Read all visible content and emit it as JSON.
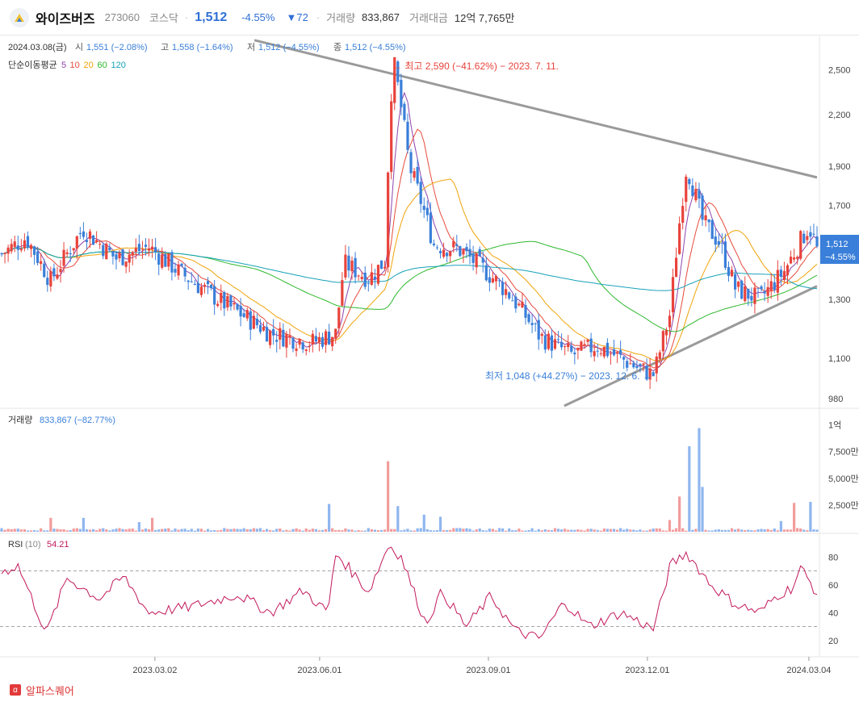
{
  "header": {
    "name": "와이즈버즈",
    "code": "273060",
    "market": "코스닥",
    "price": "1,512",
    "change_rate": "-4.55%",
    "change": "▼72",
    "volume_label": "거래량",
    "volume": "833,867",
    "amount_label": "거래대금",
    "amount": "12억 7,765만"
  },
  "info": {
    "date": "2024.03.08(금)",
    "open_label": "시",
    "open": "1,551 (−2.08%)",
    "high_label": "고",
    "high": "1,558 (−1.64%)",
    "low_label": "저",
    "low": "1,512 (−4.55%)",
    "close_label": "종",
    "close": "1,512 (−4.55%)",
    "ma_label": "단순이동평균",
    "ma_periods": [
      "5",
      "10",
      "20",
      "60",
      "120"
    ],
    "ma_colors": [
      "#8e44ad",
      "#e74c3c",
      "#f0a30a",
      "#2eb82e",
      "#17a2b8"
    ]
  },
  "annotations": {
    "high": "← 최고 2,590 (−41.62%) − 2023. 7. 11.",
    "low": "최저 1,048 (+44.27%) − 2023. 12. 6. →"
  },
  "current_tag": {
    "price": "1,512",
    "rate": "−4.55%"
  },
  "volume_panel": {
    "label": "거래량",
    "value": "833,867 (−82.77%)",
    "ticks": [
      "1억",
      "7,500만",
      "5,000만",
      "2,500만"
    ]
  },
  "rsi_panel": {
    "label": "RSI",
    "period": "(10)",
    "value": "54.21",
    "ticks": [
      "80",
      "60",
      "40",
      "20"
    ]
  },
  "footer": {
    "brand": "알파스퀘어",
    "icon": "α"
  },
  "colors": {
    "up": "#e8433c",
    "down": "#3a7fd9",
    "up_vol": "#f29c9c",
    "down_vol": "#8fb6ef",
    "rsi": "#c2185b",
    "trend": "#9a9a9a"
  },
  "chart_data": {
    "type": "candlestick",
    "price_ticks": [
      "2,500",
      "2,200",
      "1,900",
      "1,700",
      "1,300",
      "1,100",
      "980"
    ],
    "x_ticks": [
      "2023.03.02",
      "2023.06.01",
      "2023.09.01",
      "2023.12.01",
      "2024.03.04"
    ],
    "price_scale": "log",
    "price_range": [
      960,
      2700
    ],
    "volume_range": [
      0,
      105000000
    ],
    "rsi_range": [
      10,
      90
    ],
    "rsi_levels": [
      70,
      30
    ],
    "trendlines": [
      {
        "from": [
          0.31,
          2720
        ],
        "to": [
          1.0,
          1840
        ]
      },
      {
        "from": [
          0.69,
          960
        ],
        "to": [
          1.0,
          1350
        ]
      }
    ],
    "anchors": [
      [
        0,
        1480
      ],
      [
        0.03,
        1550
      ],
      [
        0.06,
        1370
      ],
      [
        0.1,
        1590
      ],
      [
        0.14,
        1460
      ],
      [
        0.18,
        1510
      ],
      [
        0.22,
        1400
      ],
      [
        0.27,
        1290
      ],
      [
        0.33,
        1180
      ],
      [
        0.38,
        1150
      ],
      [
        0.41,
        1180
      ],
      [
        0.42,
        1440
      ],
      [
        0.45,
        1380
      ],
      [
        0.47,
        1450
      ],
      [
        0.48,
        2590
      ],
      [
        0.5,
        1900
      ],
      [
        0.53,
        1520
      ],
      [
        0.56,
        1500
      ],
      [
        0.59,
        1420
      ],
      [
        0.62,
        1330
      ],
      [
        0.66,
        1170
      ],
      [
        0.7,
        1110
      ],
      [
        0.73,
        1140
      ],
      [
        0.78,
        1070
      ],
      [
        0.8,
        1048
      ],
      [
        0.82,
        1250
      ],
      [
        0.84,
        1900
      ],
      [
        0.86,
        1620
      ],
      [
        0.88,
        1530
      ],
      [
        0.9,
        1340
      ],
      [
        0.93,
        1300
      ],
      [
        0.96,
        1410
      ],
      [
        0.99,
        1600
      ],
      [
        1.0,
        1512
      ]
    ],
    "volume_spikes": [
      [
        0.06,
        13
      ],
      [
        0.1,
        13
      ],
      [
        0.17,
        9
      ],
      [
        0.185,
        13
      ],
      [
        0.4,
        26
      ],
      [
        0.475,
        66
      ],
      [
        0.485,
        24
      ],
      [
        0.52,
        16
      ],
      [
        0.54,
        14
      ],
      [
        0.82,
        11
      ],
      [
        0.83,
        33
      ],
      [
        0.845,
        80
      ],
      [
        0.855,
        97
      ],
      [
        0.86,
        42
      ],
      [
        0.955,
        10
      ],
      [
        0.97,
        27
      ],
      [
        0.99,
        28
      ]
    ],
    "rsi_anchors": [
      [
        0,
        69
      ],
      [
        0.02,
        74
      ],
      [
        0.055,
        25
      ],
      [
        0.08,
        65
      ],
      [
        0.12,
        50
      ],
      [
        0.15,
        66
      ],
      [
        0.18,
        40
      ],
      [
        0.23,
        44
      ],
      [
        0.29,
        53
      ],
      [
        0.33,
        40
      ],
      [
        0.37,
        56
      ],
      [
        0.4,
        40
      ],
      [
        0.41,
        83
      ],
      [
        0.45,
        55
      ],
      [
        0.475,
        89
      ],
      [
        0.49,
        80
      ],
      [
        0.52,
        32
      ],
      [
        0.54,
        55
      ],
      [
        0.57,
        30
      ],
      [
        0.6,
        52
      ],
      [
        0.63,
        27
      ],
      [
        0.66,
        21
      ],
      [
        0.69,
        48
      ],
      [
        0.72,
        30
      ],
      [
        0.76,
        40
      ],
      [
        0.8,
        28
      ],
      [
        0.82,
        74
      ],
      [
        0.84,
        83
      ],
      [
        0.87,
        60
      ],
      [
        0.9,
        46
      ],
      [
        0.93,
        40
      ],
      [
        0.95,
        52
      ],
      [
        0.97,
        58
      ],
      [
        0.98,
        72
      ],
      [
        1.0,
        54
      ]
    ],
    "summary": {
      "high": 2590,
      "low": 1048,
      "last": 1512
    }
  }
}
